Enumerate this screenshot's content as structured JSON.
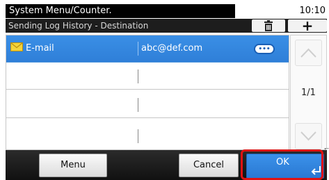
{
  "status_bar": {
    "title": "System Menu/Counter.",
    "time": "10:10"
  },
  "header": {
    "title": "Sending Log History - Destination",
    "delete_icon": "trash-icon",
    "add_icon": "plus-icon"
  },
  "list": {
    "rows": [
      {
        "type_icon": "envelope-icon",
        "name": "E-mail",
        "destination": "abc@def.com",
        "selected": true,
        "detail_icon": "more-icon"
      },
      {
        "name": "",
        "destination": "",
        "selected": false
      },
      {
        "name": "",
        "destination": "",
        "selected": false
      },
      {
        "name": "",
        "destination": "",
        "selected": false
      }
    ]
  },
  "scroll": {
    "up_icon": "chevron-up-icon",
    "down_icon": "chevron-down-icon",
    "page": "1/1"
  },
  "buttons": {
    "menu": "Menu",
    "cancel": "Cancel",
    "ok": "OK",
    "ok_icon": "enter-arrow-icon"
  },
  "colors": {
    "selection": "#2f7fd8",
    "highlight": "#e01212",
    "header_bg": "#1d1d1d"
  }
}
